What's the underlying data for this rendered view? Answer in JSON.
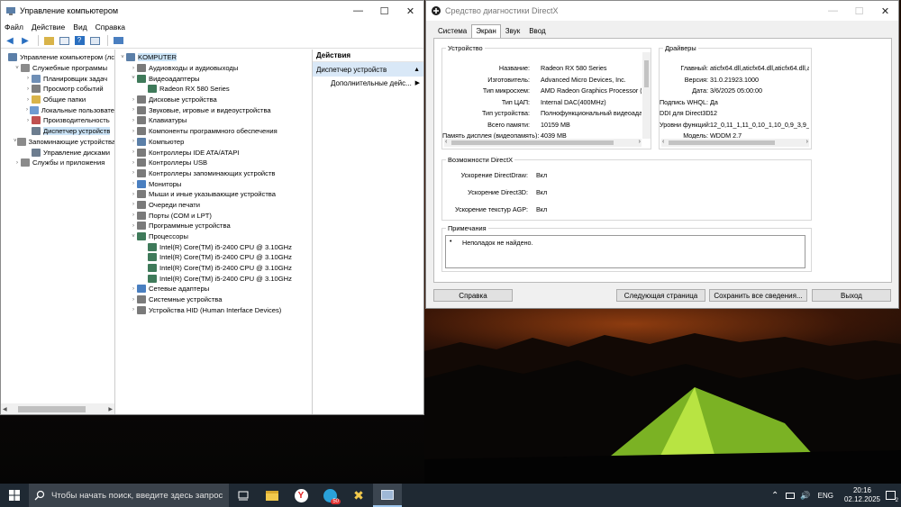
{
  "comp_mgmt": {
    "title": "Управление компьютером",
    "menu": [
      "Файл",
      "Действие",
      "Вид",
      "Справка"
    ],
    "left_tree": [
      {
        "label": "Управление компьютером (лс",
        "level": 0,
        "exp": "",
        "icon": "computer-icon",
        "color": "#5b7fa8"
      },
      {
        "label": "Служебные программы",
        "level": 1,
        "exp": "v",
        "icon": "tools-icon",
        "color": "#8b8b8b"
      },
      {
        "label": "Планировщик задач",
        "level": 2,
        "exp": ">",
        "icon": "clock-icon",
        "color": "#6f8fb6"
      },
      {
        "label": "Просмотр событий",
        "level": 2,
        "exp": ">",
        "icon": "event-viewer-icon",
        "color": "#7f7f7f"
      },
      {
        "label": "Общие папки",
        "level": 2,
        "exp": ">",
        "icon": "folder-icon",
        "color": "#d9b44a"
      },
      {
        "label": "Локальные пользовате",
        "level": 2,
        "exp": ">",
        "icon": "users-icon",
        "color": "#6f9bd1"
      },
      {
        "label": "Производительность",
        "level": 2,
        "exp": ">",
        "icon": "performance-icon",
        "color": "#c05050"
      },
      {
        "label": "Диспетчер устройств",
        "level": 2,
        "exp": "",
        "icon": "device-manager-icon",
        "color": "#6d7d8f",
        "selected": true
      },
      {
        "label": "Запоминающие устройства",
        "level": 1,
        "exp": "v",
        "icon": "storage-icon",
        "color": "#8b8b8b"
      },
      {
        "label": "Управление дисками",
        "level": 2,
        "exp": "",
        "icon": "disk-icon",
        "color": "#6d7d8f"
      },
      {
        "label": "Службы и приложения",
        "level": 1,
        "exp": ">",
        "icon": "services-icon",
        "color": "#8b8b8b"
      }
    ],
    "device_tree": [
      {
        "label": "KOMPUTER",
        "level": 0,
        "exp": "v",
        "icon": "computer-icon",
        "color": "#5b7fa8",
        "selected": true
      },
      {
        "label": "Аудиовходы и аудиовыходы",
        "level": 1,
        "exp": ">",
        "icon": "audio-icon",
        "color": "#7a7a7a"
      },
      {
        "label": "Видеоадаптеры",
        "level": 1,
        "exp": "v",
        "icon": "display-adapter-icon",
        "color": "#3f7a5a"
      },
      {
        "label": "Radeon RX 580 Series",
        "level": 2,
        "exp": "",
        "icon": "display-adapter-icon",
        "color": "#3f7a5a"
      },
      {
        "label": "Дисковые устройства",
        "level": 1,
        "exp": ">",
        "icon": "disk-icon",
        "color": "#7a7a7a"
      },
      {
        "label": "Звуковые, игровые и видеоустройства",
        "level": 1,
        "exp": ">",
        "icon": "sound-icon",
        "color": "#7a7a7a"
      },
      {
        "label": "Клавиатуры",
        "level": 1,
        "exp": ">",
        "icon": "keyboard-icon",
        "color": "#7a7a7a"
      },
      {
        "label": "Компоненты программного обеспечения",
        "level": 1,
        "exp": ">",
        "icon": "software-component-icon",
        "color": "#7a7a7a"
      },
      {
        "label": "Компьютер",
        "level": 1,
        "exp": ">",
        "icon": "computer-icon",
        "color": "#5b7fa8"
      },
      {
        "label": "Контроллеры IDE ATA/ATAPI",
        "level": 1,
        "exp": ">",
        "icon": "ide-controller-icon",
        "color": "#7a7a7a"
      },
      {
        "label": "Контроллеры USB",
        "level": 1,
        "exp": ">",
        "icon": "usb-icon",
        "color": "#7a7a7a"
      },
      {
        "label": "Контроллеры запоминающих устройств",
        "level": 1,
        "exp": ">",
        "icon": "storage-controller-icon",
        "color": "#7a7a7a"
      },
      {
        "label": "Мониторы",
        "level": 1,
        "exp": ">",
        "icon": "monitor-icon",
        "color": "#4a7fc0"
      },
      {
        "label": "Мыши и иные указывающие устройства",
        "level": 1,
        "exp": ">",
        "icon": "mouse-icon",
        "color": "#7a7a7a"
      },
      {
        "label": "Очереди печати",
        "level": 1,
        "exp": ">",
        "icon": "printer-icon",
        "color": "#7a7a7a"
      },
      {
        "label": "Порты (COM и LPT)",
        "level": 1,
        "exp": ">",
        "icon": "port-icon",
        "color": "#7a7a7a"
      },
      {
        "label": "Программные устройства",
        "level": 1,
        "exp": ">",
        "icon": "software-device-icon",
        "color": "#7a7a7a"
      },
      {
        "label": "Процессоры",
        "level": 1,
        "exp": "v",
        "icon": "processor-icon",
        "color": "#3f7a5a"
      },
      {
        "label": "Intel(R) Core(TM) i5-2400 CPU @ 3.10GHz",
        "level": 2,
        "exp": "",
        "icon": "processor-icon",
        "color": "#3f7a5a"
      },
      {
        "label": "Intel(R) Core(TM) i5-2400 CPU @ 3.10GHz",
        "level": 2,
        "exp": "",
        "icon": "processor-icon",
        "color": "#3f7a5a"
      },
      {
        "label": "Intel(R) Core(TM) i5-2400 CPU @ 3.10GHz",
        "level": 2,
        "exp": "",
        "icon": "processor-icon",
        "color": "#3f7a5a"
      },
      {
        "label": "Intel(R) Core(TM) i5-2400 CPU @ 3.10GHz",
        "level": 2,
        "exp": "",
        "icon": "processor-icon",
        "color": "#3f7a5a"
      },
      {
        "label": "Сетевые адаптеры",
        "level": 1,
        "exp": ">",
        "icon": "network-adapter-icon",
        "color": "#4a7fc0"
      },
      {
        "label": "Системные устройства",
        "level": 1,
        "exp": ">",
        "icon": "system-device-icon",
        "color": "#7a7a7a"
      },
      {
        "label": "Устройства HID (Human Interface Devices)",
        "level": 1,
        "exp": ">",
        "icon": "hid-icon",
        "color": "#7a7a7a"
      }
    ],
    "actions": {
      "header": "Действия",
      "section": "Диспетчер устройств",
      "more": "Дополнительные дейс..."
    }
  },
  "dxdiag": {
    "title": "Средство диагностики DirectX",
    "tabs": [
      "Система",
      "Экран",
      "Звук",
      "Ввод"
    ],
    "active_tab": "Экран",
    "device_title": "Устройство",
    "device": [
      {
        "k": "Название:",
        "v": "Radeon RX 580 Series"
      },
      {
        "k": "Изготовитель:",
        "v": "Advanced Micro Devices, Inc."
      },
      {
        "k": "Тип микросхем:",
        "v": "AMD Radeon Graphics Processor (0x"
      },
      {
        "k": "Тип ЦАП:",
        "v": "Internal DAC(400MHz)"
      },
      {
        "k": "Тип устройства:",
        "v": "Полнофункциональный видеоадапт"
      },
      {
        "k": "Всего памяти:",
        "v": "10159 MB"
      },
      {
        "k": "Память дисплея (видеопамять):",
        "v": "4039 MB"
      }
    ],
    "drivers_title": "Драйверы",
    "drivers": [
      {
        "k": "Главный:",
        "v": "aticfx64.dll,aticfx64.dll,aticfx64.dll,am"
      },
      {
        "k": "Версия:",
        "v": "31.0.21923.1000"
      },
      {
        "k": "Дата:",
        "v": "3/6/2025 05:00:00"
      },
      {
        "k": "Подпись WHQL:",
        "v": "Да"
      },
      {
        "k": "DDI для Direct3D:",
        "v": "12"
      },
      {
        "k": "Уровни функций:",
        "v": "12_0,11_1,11_0,10_1,10_0,9_3,9_2,9"
      },
      {
        "k": "Модель:",
        "v": "WDDM 2.7"
      }
    ],
    "dx_title": "Возможности DirectX",
    "dx_features": [
      {
        "k": "Ускорение DirectDraw:",
        "v": "Вкл"
      },
      {
        "k": "Ускорение Direct3D:",
        "v": "Вкл"
      },
      {
        "k": "Ускорение текстур AGP:",
        "v": "Вкл"
      }
    ],
    "notes_title": "Примечания",
    "notes": "Неполадок не найдено.",
    "buttons": {
      "help": "Справка",
      "next": "Следующая страница",
      "save": "Сохранить все сведения...",
      "exit": "Выход"
    }
  },
  "taskbar": {
    "search_placeholder": "Чтобы начать поиск, введите здесь запрос",
    "lang": "ENG",
    "time": "20:16",
    "date": "02.12.2025",
    "notif_count": "2",
    "badge": "50"
  }
}
